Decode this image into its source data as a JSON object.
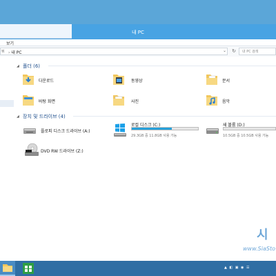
{
  "window": {
    "title": "내 PC"
  },
  "ribbon": {
    "view_tab": "보기"
  },
  "address": {
    "back": "뒤",
    "path": "내 PC",
    "dropdown": "⌄",
    "refresh": "↻",
    "search_placeholder": "내 PC 검색"
  },
  "folders": {
    "header": "폴더 (6)",
    "items": [
      {
        "label": "다운로드",
        "icon": "download-folder-icon"
      },
      {
        "label": "동영상",
        "icon": "video-folder-icon"
      },
      {
        "label": "문서",
        "icon": "documents-folder-icon"
      },
      {
        "label": "바탕 화면",
        "icon": "desktop-folder-icon"
      },
      {
        "label": "사진",
        "icon": "pictures-folder-icon"
      },
      {
        "label": "음악",
        "icon": "music-folder-icon"
      }
    ]
  },
  "devices": {
    "header": "장치 및 드라이브 (4)",
    "items": [
      {
        "label": "플로피 디스크 드라이브 (A:)",
        "icon": "floppy-drive-icon"
      },
      {
        "label": "로컬 디스크 (C:)",
        "sub": "29.3GB 중 11.8GB 사용 가능",
        "used_fraction": 0.6,
        "icon": "windows-drive-icon"
      },
      {
        "label": "새 볼륨 (D:)",
        "sub": "10.5GB 중 10.5GB 사용 가능",
        "used_fraction": 0.0,
        "icon": "hard-drive-icon"
      },
      {
        "label": "DVD RW 드라이브 (Z:)",
        "icon": "dvd-drive-icon"
      }
    ]
  },
  "watermark": {
    "line1": "시",
    "line2": "www.SiaSto"
  },
  "colors": {
    "accent": "#48a3e3",
    "bar_fill": "#26a0da",
    "section": "#1e4e8c"
  }
}
